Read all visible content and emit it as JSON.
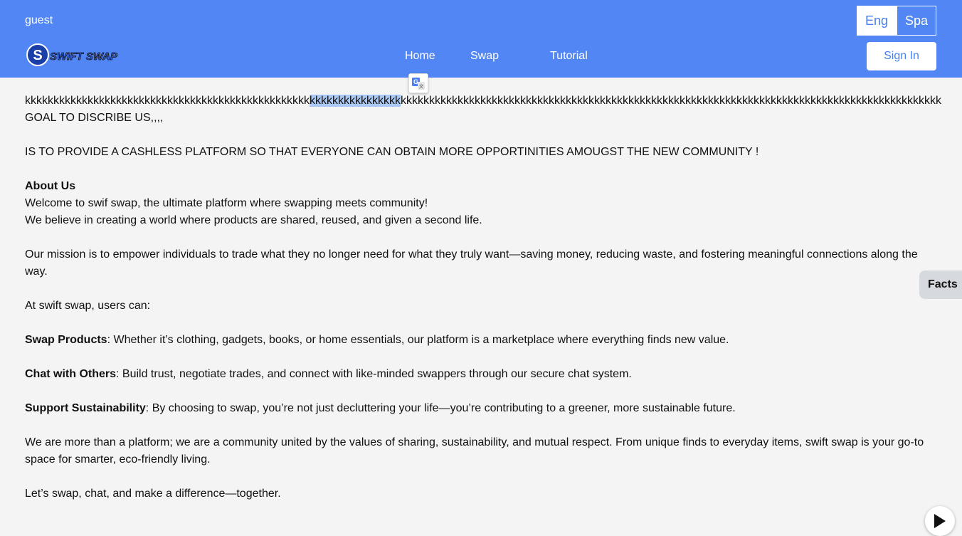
{
  "header": {
    "user_label": "guest",
    "lang_eng": "Eng",
    "lang_spa": "Spa",
    "logo_text": "SWIFT SWAP",
    "nav": [
      "Home",
      "Swap",
      "Tutorial"
    ],
    "sign_in": "Sign In",
    "colors": {
      "bar": "#5286f4",
      "accent": "#4a80ef"
    }
  },
  "content": {
    "k_before": "kkkkkkkkkkkkkkkkkkkkkkkkkkkkkkkkkkkkkkkkkkkkkkkkkk",
    "k_selected": "kkkkkkkkkkkkkkkk",
    "k_after": "kkkkkkkkkkkkkkkkkkkkkkkkkkkkkkkkkkkkkkkkkkkkkkkkkkkkkkkkkkkkkkkkkkkkkkkkkkkkkkkkkkkkkkkkkkkkkkk",
    "goal_line": "GOAL TO DISCRIBE US,,,,",
    "mission_caps": "IS TO PROVIDE A CASHLESS PLATFORM SO THAT EVERYONE CAN OBTAIN MORE OPPORTINITIES AMOUGST THE NEW COMMUNITY !",
    "about_heading": "About Us",
    "welcome": "Welcome to swif swap, the ultimate platform where swapping meets community!",
    "believe": "We believe in creating a world where products are shared, reused, and given a second life.",
    "mission": "Our mission is to empower individuals to trade what they no longer need for what they truly want—saving money, reducing waste, and fostering meaningful connections along the way.",
    "users_can": "At swift swap, users can:",
    "swap_title": "Swap Products",
    "swap_text": ": Whether it’s clothing, gadgets, books, or home essentials, our platform is a marketplace where everything finds new value.",
    "chat_title": "Chat with Others",
    "chat_text": ": Build trust, negotiate trades, and connect with like-minded swappers through our secure chat system.",
    "support_title": "Support Sustainability",
    "support_text": ": By choosing to swap, you’re not just decluttering your life—you’re contributing to a greener, more sustainable future.",
    "community": "We are more than a platform; we are a community united by the values of sharing, sustainability, and mutual respect. From unique finds to everyday items, swift swap is your go-to space for smarter, eco-friendly living.",
    "closing": "Let’s swap, chat, and make a difference—together."
  },
  "side": {
    "facts": "Facts"
  },
  "icons": {
    "translate": "google-translate-icon",
    "play": "play-icon"
  }
}
